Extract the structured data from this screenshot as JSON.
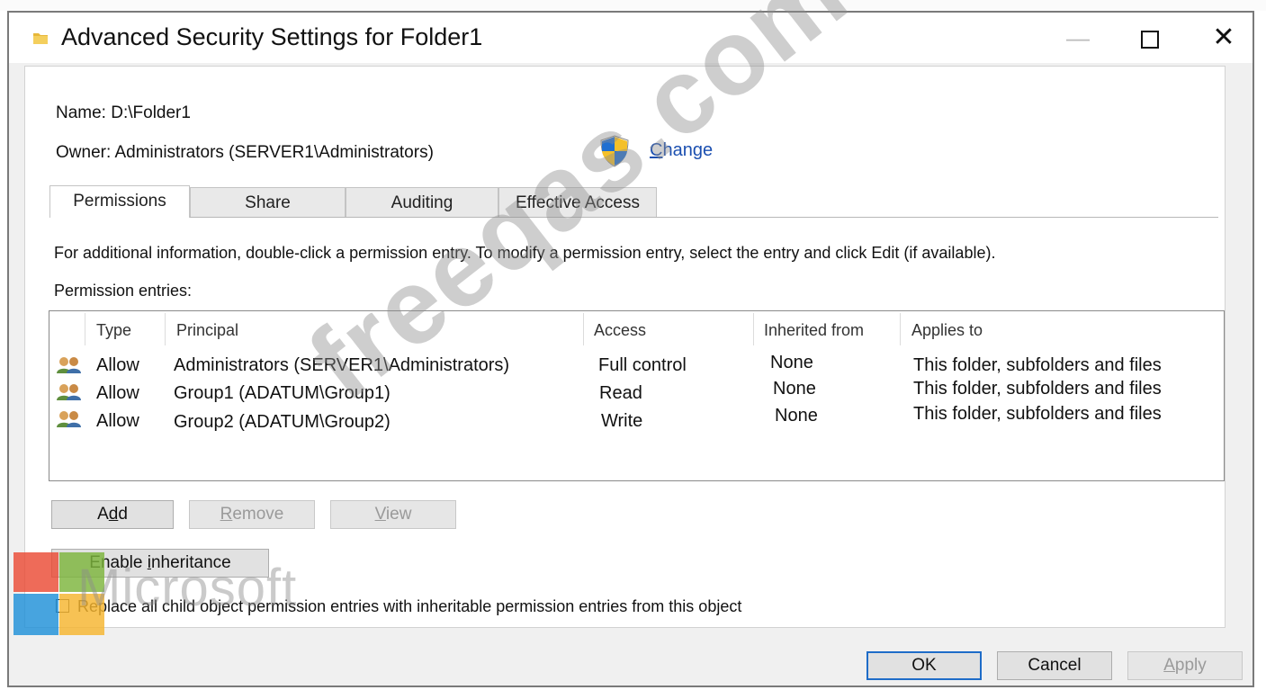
{
  "window": {
    "title": "Advanced Security Settings for Folder1",
    "min_glyph": "—",
    "close_glyph": "✕"
  },
  "name_label": "Name:",
  "name_value": "D:\\Folder1",
  "owner_label": "Owner:",
  "owner_value": "Administrators (SERVER1\\Administrators)",
  "change_link": {
    "first": "C",
    "rest": "hange"
  },
  "tabs": [
    {
      "label": "Permissions",
      "active": true
    },
    {
      "label": "Share"
    },
    {
      "label": "Auditing"
    },
    {
      "label": "Effective Access"
    }
  ],
  "info_text": "For additional information, double-click a permission entry. To modify a permission entry, select the entry and click Edit (if available).",
  "entries_label": "Permission entries:",
  "table": {
    "columns": [
      "Type",
      "Principal",
      "Access",
      "Inherited from",
      "Applies to"
    ],
    "rows": [
      {
        "type": "Allow",
        "principal": "Administrators (SERVER1\\Administrators)",
        "access": "Full control",
        "inherited": "None",
        "applies": "This folder, subfolders and files"
      },
      {
        "type": "Allow",
        "principal": "Group1 (ADATUM\\Group1)",
        "access": "Read",
        "inherited": "None",
        "applies": "This folder, subfolders and files"
      },
      {
        "type": "Allow",
        "principal": "Group2 (ADATUM\\Group2)",
        "access": "Write",
        "inherited": "None",
        "applies": "This folder, subfolders and files"
      }
    ]
  },
  "buttons": {
    "add": {
      "a": "A",
      "u": "d",
      "b": "d"
    },
    "remove": {
      "u": "R",
      "b": "emove"
    },
    "view": {
      "u": "V",
      "b": "iew"
    },
    "enable_inheritance": {
      "a": "Enable ",
      "u": "i",
      "b": "nheritance"
    },
    "ok": "OK",
    "cancel": "Cancel",
    "apply": {
      "u": "A",
      "b": "pply"
    }
  },
  "replace_checkbox": {
    "checked": false,
    "label": "Replace all child object permission entries with inheritable permission entries from this object"
  },
  "watermarks": {
    "site": "freeqas.com",
    "brand": "Microsoft"
  },
  "colors": {
    "ms_red": "#ea4a35",
    "ms_green": "#7cb43c",
    "ms_blue": "#1e90d8",
    "ms_yellow": "#f5b52e",
    "link": "#1b4fb0",
    "default_button_border": "#1e6cc8"
  },
  "icons": [
    "folder-icon",
    "shield-icon",
    "users-icon"
  ]
}
